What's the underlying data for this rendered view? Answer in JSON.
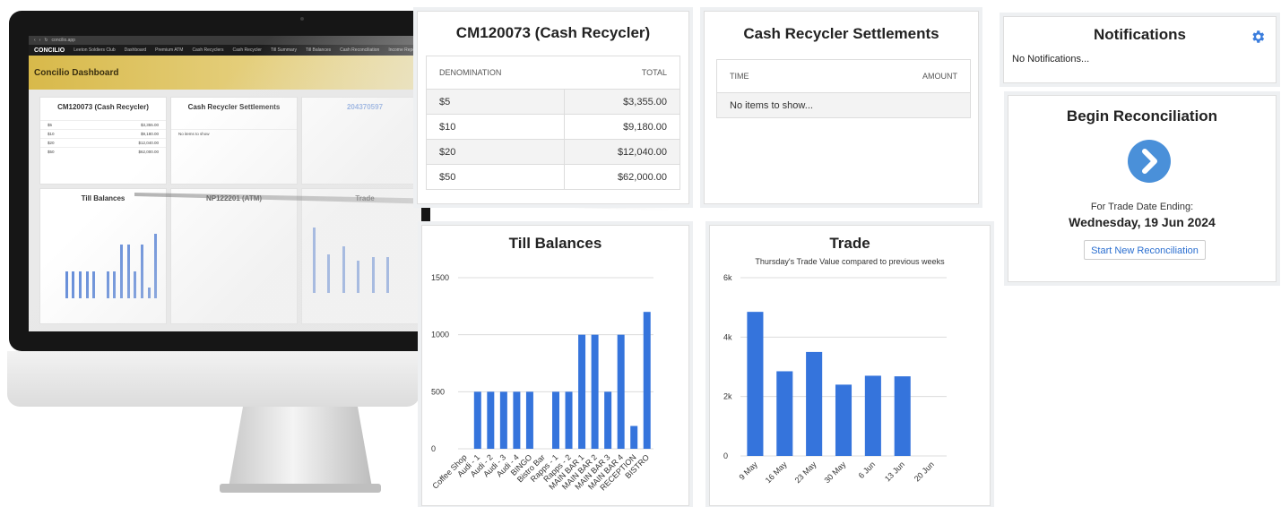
{
  "mockup": {
    "browser_url": "concilio.app",
    "nav": {
      "logo": "CONCILIO",
      "items": [
        "Leeton Soldiers Club",
        "Dashboard",
        "Premium ATM",
        "Cash Recyclers",
        "Cash Recycler",
        "Till Summary",
        "Till Balances",
        "Cash Reconciliation",
        "Income Report"
      ]
    },
    "header_title": "Concilio Dashboard",
    "cards": {
      "cash_recycler": "CM120073 (Cash Recycler)",
      "settlements": "Cash Recycler Settlements",
      "till_balances": "Till Balances",
      "atm": "NP122201 (ATM)",
      "trade": "Trade",
      "atm_number": "204370597",
      "no_items": "No items to show"
    }
  },
  "cash_recycler": {
    "title": "CM120073 (Cash Recycler)",
    "columns": [
      "DENOMINATION",
      "TOTAL"
    ],
    "rows": [
      {
        "denomination": "$5",
        "total": "$3,355.00"
      },
      {
        "denomination": "$10",
        "total": "$9,180.00"
      },
      {
        "denomination": "$20",
        "total": "$12,040.00"
      },
      {
        "denomination": "$50",
        "total": "$62,000.00"
      }
    ]
  },
  "settlements": {
    "title": "Cash Recycler Settlements",
    "columns": [
      "TIME",
      "AMOUNT"
    ],
    "empty_text": "No items to show..."
  },
  "notifications": {
    "title": "Notifications",
    "empty_text": "No Notifications...",
    "icon": "gear-icon",
    "icon_color": "#3b7ddd"
  },
  "reconciliation": {
    "title": "Begin Reconciliation",
    "icon": "chevron-right-icon",
    "icon_color": "#4a90d9",
    "date_label": "For Trade Date Ending:",
    "date_value": "Wednesday, 19 Jun 2024",
    "button_label": "Start New Reconciliation"
  },
  "chart_data": [
    {
      "type": "bar",
      "title": "Till Balances",
      "categories": [
        "Coffee Shop",
        "Audi - 1",
        "Audi - 2",
        "Audi - 3",
        "Audi - 4",
        "BINGO",
        "Bistro Bar",
        "Rapps - 1",
        "Rapps - 2",
        "MAIN BAR 1",
        "MAIN BAR 2",
        "MAIN BAR 3",
        "MAIN BAR 4",
        "RECEPTION",
        "BISTRO"
      ],
      "values": [
        0,
        500,
        500,
        500,
        500,
        500,
        0,
        500,
        500,
        1000,
        1000,
        500,
        1000,
        200,
        1200
      ],
      "yticks": [
        0,
        500,
        1000,
        1500
      ],
      "ylim": [
        0,
        1500
      ],
      "grid": true,
      "color": "#3574dc"
    },
    {
      "type": "bar",
      "title": "Trade",
      "subtitle": "Thursday's Trade Value compared to previous weeks",
      "categories": [
        "9 May",
        "16 May",
        "23 May",
        "30 May",
        "6 Jun",
        "13 Jun",
        "20 Jun"
      ],
      "values": [
        4850,
        2850,
        3500,
        2400,
        2700,
        2680,
        0
      ],
      "yticks": [
        0,
        2000,
        4000,
        6000
      ],
      "ytick_labels": [
        "0",
        "2k",
        "4k",
        "6k"
      ],
      "ylim": [
        0,
        6000
      ],
      "grid": true,
      "color": "#3574dc"
    }
  ]
}
